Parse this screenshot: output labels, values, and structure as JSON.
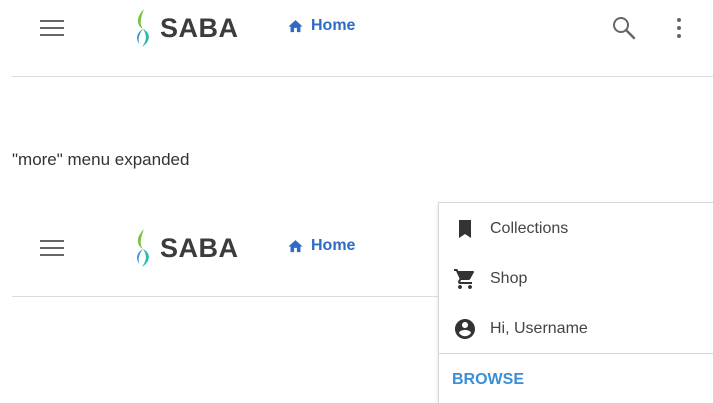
{
  "brand": {
    "name": "SABA"
  },
  "nav": {
    "home_label": "Home"
  },
  "caption": "\"more\" menu expanded",
  "more_menu": {
    "items": [
      {
        "label": "Collections",
        "icon": "bookmark-icon"
      },
      {
        "label": "Shop",
        "icon": "cart-icon"
      },
      {
        "label": "Hi, Username",
        "icon": "account-circle-icon"
      }
    ],
    "browse_label": "BROWSE"
  },
  "colors": {
    "link": "#2d6bc7",
    "browse": "#3a8fd6",
    "logo_teal": "#2fb7b0",
    "logo_green": "#7cc242",
    "logo_blue": "#3a8fd6"
  }
}
